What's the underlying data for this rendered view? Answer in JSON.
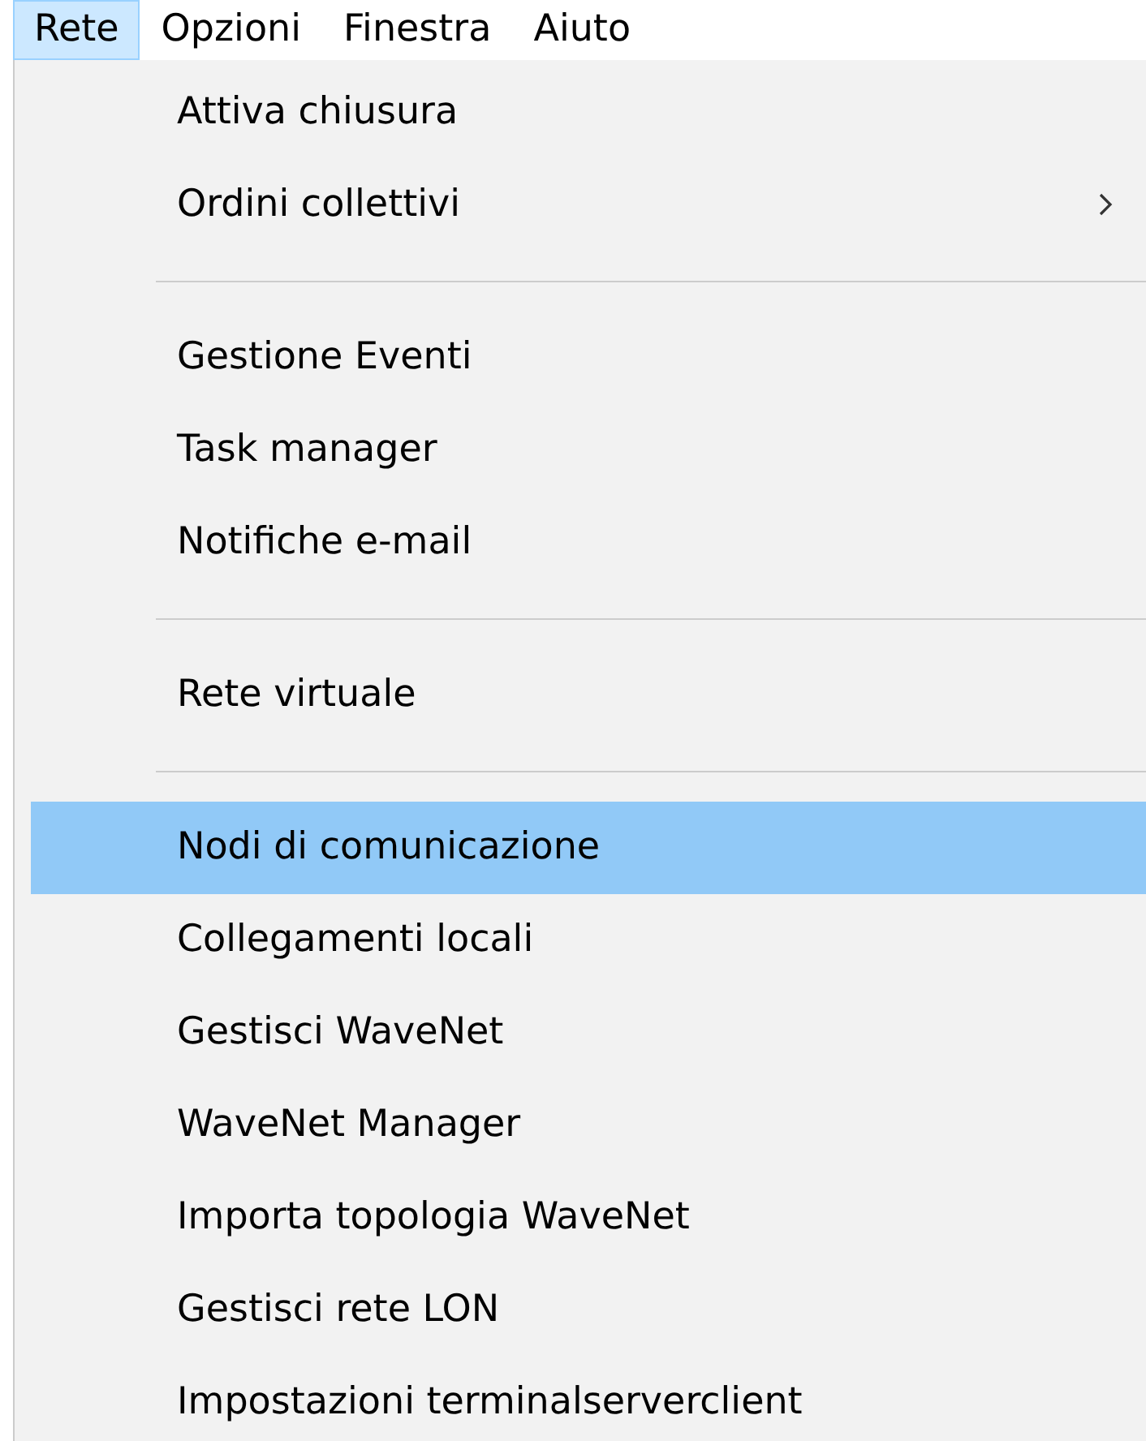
{
  "menubar": [
    {
      "label": "Rete",
      "selected": true
    },
    {
      "label": "Opzioni",
      "selected": false
    },
    {
      "label": "Finestra",
      "selected": false
    },
    {
      "label": "Aiuto",
      "selected": false
    }
  ],
  "menu": [
    {
      "kind": "item",
      "label": "Attiva chiusura",
      "submenu": false,
      "selected": false
    },
    {
      "kind": "item",
      "label": "Ordini collettivi",
      "submenu": true,
      "selected": false
    },
    {
      "kind": "separator"
    },
    {
      "kind": "item",
      "label": "Gestione Eventi",
      "submenu": false,
      "selected": false
    },
    {
      "kind": "item",
      "label": "Task manager",
      "submenu": false,
      "selected": false
    },
    {
      "kind": "item",
      "label": "Notifiche e-mail",
      "submenu": false,
      "selected": false
    },
    {
      "kind": "separator"
    },
    {
      "kind": "item",
      "label": "Rete virtuale",
      "submenu": false,
      "selected": false
    },
    {
      "kind": "separator"
    },
    {
      "kind": "item",
      "label": "Nodi di comunicazione",
      "submenu": false,
      "selected": true
    },
    {
      "kind": "item",
      "label": "Collegamenti locali",
      "submenu": false,
      "selected": false
    },
    {
      "kind": "item",
      "label": "Gestisci WaveNet",
      "submenu": false,
      "selected": false
    },
    {
      "kind": "item",
      "label": "WaveNet Manager",
      "submenu": false,
      "selected": false
    },
    {
      "kind": "item",
      "label": "Importa topologia WaveNet",
      "submenu": false,
      "selected": false
    },
    {
      "kind": "item",
      "label": "Gestisci rete LON",
      "submenu": false,
      "selected": false
    },
    {
      "kind": "item",
      "label": "Impostazioni terminalserverclient",
      "submenu": false,
      "selected": false
    }
  ]
}
